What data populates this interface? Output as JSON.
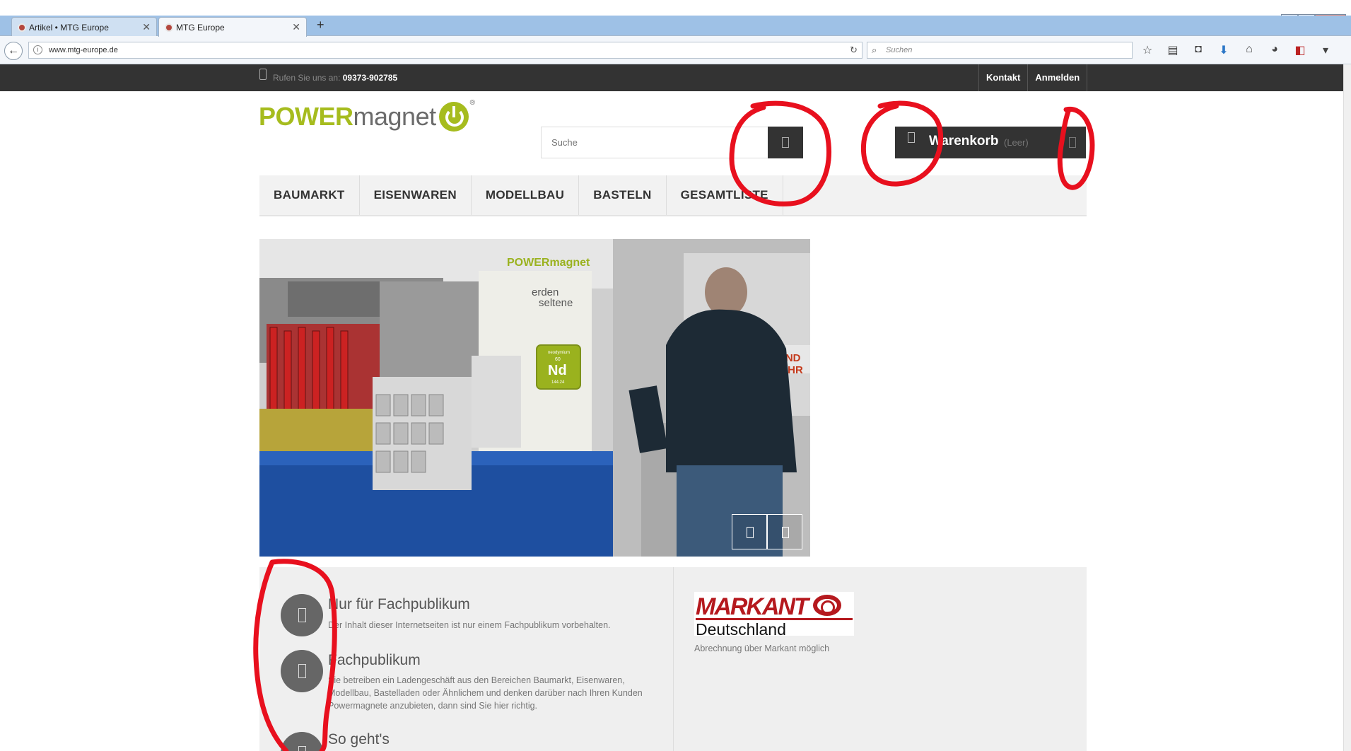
{
  "browser": {
    "tabs": [
      {
        "label": "Artikel • MTG Europe",
        "active": false
      },
      {
        "label": "MTG Europe",
        "active": true
      }
    ],
    "new_tab": "+",
    "url": "www.mtg-europe.de",
    "search_placeholder": "Suchen"
  },
  "topbar": {
    "phone_label": "Rufen Sie uns an:",
    "phone_number": "09373-902785",
    "links": [
      "Kontakt",
      "Anmelden"
    ]
  },
  "header": {
    "logo_power": "POWER",
    "logo_magnet": "magnet",
    "logo_reg": "®",
    "search_placeholder": "Suche",
    "cart_title": "Warenkorb",
    "cart_status": "(Leer)"
  },
  "menu": [
    "BAUMARKT",
    "EISENWAREN",
    "MODELLBAU",
    "BASTELN",
    "GESAMTLISTE"
  ],
  "slider_image": {
    "banner_logo": "POWERmagnet",
    "banner_word1": "erden",
    "banner_word2": "seltene",
    "element_name": "neodymium",
    "element_number": "60",
    "element_symbol": "Nd",
    "element_mass": "144.24",
    "wall_text1": "N UND",
    "wall_text2": "TFÜHR"
  },
  "features": [
    {
      "title": "Nur für Fachpublikum",
      "text": "Der Inhalt dieser Internetseiten ist nur einem Fachpublikum vorbehalten."
    },
    {
      "title": "Fachpublikum",
      "text": "Sie betreiben ein Ladengeschäft aus den Bereichen Baumarkt, Eisenwaren, Modellbau, Bastelladen oder Ähnlichem und denken darüber nach Ihren Kunden Powermagnete anzubieten, dann sind Sie hier richtig."
    },
    {
      "title": "So geht's",
      "text": ""
    }
  ],
  "partner": {
    "brand": "MARKANT",
    "country": "Deutschland",
    "note": "Abrechnung über Markant möglich"
  },
  "colors": {
    "brand_green": "#a6bc1e",
    "dark_bar": "#333333",
    "markant_red": "#b5191e",
    "annotation_red": "#e8101e"
  }
}
